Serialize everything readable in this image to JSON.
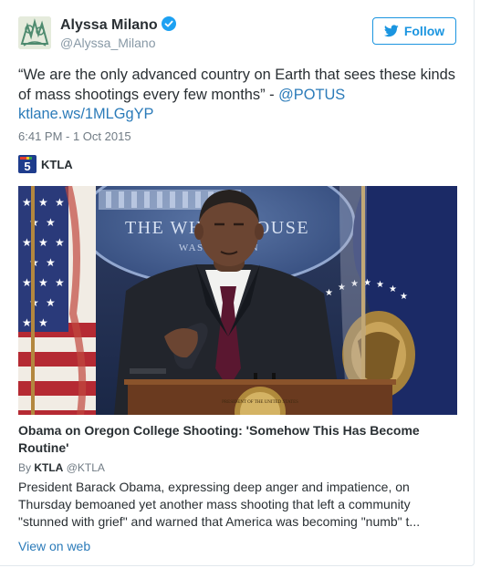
{
  "tweet": {
    "author": {
      "name": "Alyssa Milano",
      "handle": "@Alyssa_Milano",
      "verified": true
    },
    "follow_label": "Follow",
    "text_quote": "“We are the only advanced country on Earth that sees these kinds of mass shootings every few months” - ",
    "mention": "@POTUS",
    "link": "ktlane.ws/1MLGgYP",
    "timestamp": "6:41 PM - 1 Oct 2015"
  },
  "card": {
    "source_name": "KTLA",
    "logo_number": "5",
    "image_sign_line1": "THE WHITE HOUSE",
    "image_sign_line2": "WASHINGTON",
    "image_seal_text": "PRESIDENT OF THE UNITED STATES",
    "title": "Obama on Oregon College Shooting: 'Somehow This Has Become Routine'",
    "byline_prefix": "By",
    "byline_name": "KTLA",
    "byline_handle": "@KTLA",
    "description": "President Barack Obama, expressing deep anger and impatience, on Thursday bemoaned yet another mass shooting that left a community \"stunned with grief\" and warned that America was becoming \"numb\" t...",
    "view_on_web": "View on web"
  },
  "colors": {
    "link_blue": "#2b7bb9",
    "follow_blue": "#1b95e0",
    "verified_blue": "#1da1f2",
    "ktla_blue": "#1e3c8c"
  }
}
